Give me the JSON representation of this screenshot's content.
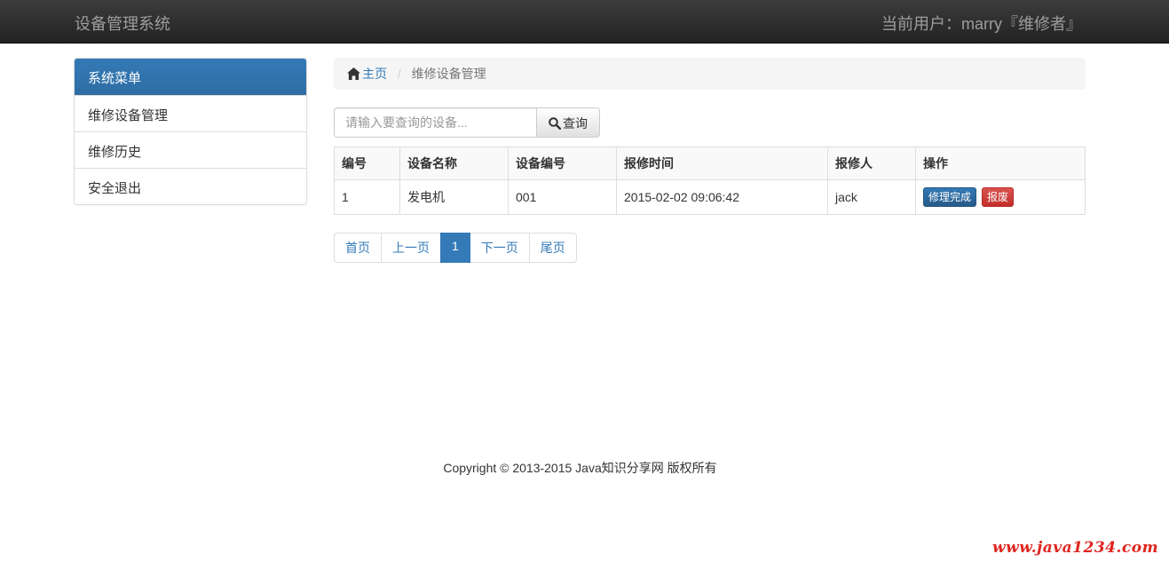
{
  "navbar": {
    "brand": "设备管理系统",
    "user_label": "当前用户：marry『维修者』"
  },
  "sidebar": {
    "title": "系统菜单",
    "items": [
      {
        "label": "维修设备管理"
      },
      {
        "label": "维修历史"
      },
      {
        "label": "安全退出"
      }
    ]
  },
  "breadcrumb": {
    "home_label": "主页",
    "home_icon": "home-icon",
    "current": "维修设备管理"
  },
  "search": {
    "placeholder": "请输入要查询的设备...",
    "value": "",
    "button_label": "查询",
    "button_icon": "search-icon"
  },
  "table": {
    "headers": [
      "编号",
      "设备名称",
      "设备编号",
      "报修时间",
      "报修人",
      "操作"
    ],
    "rows": [
      {
        "id": "1",
        "name": "发电机",
        "code": "001",
        "time": "2015-02-02 09:06:42",
        "reporter": "jack",
        "action_complete": "修理完成",
        "action_scrap": "报废"
      }
    ]
  },
  "pagination": {
    "first": "首页",
    "prev": "上一页",
    "current": "1",
    "next": "下一页",
    "last": "尾页"
  },
  "footer": {
    "copyright": "Copyright © 2013-2015 Java知识分享网 版权所有"
  },
  "watermark": {
    "text": "www.java1234.com"
  },
  "colors": {
    "primary": "#337ab7",
    "danger": "#d9534f",
    "navbar": "#222222",
    "watermark": "#e0241e"
  }
}
